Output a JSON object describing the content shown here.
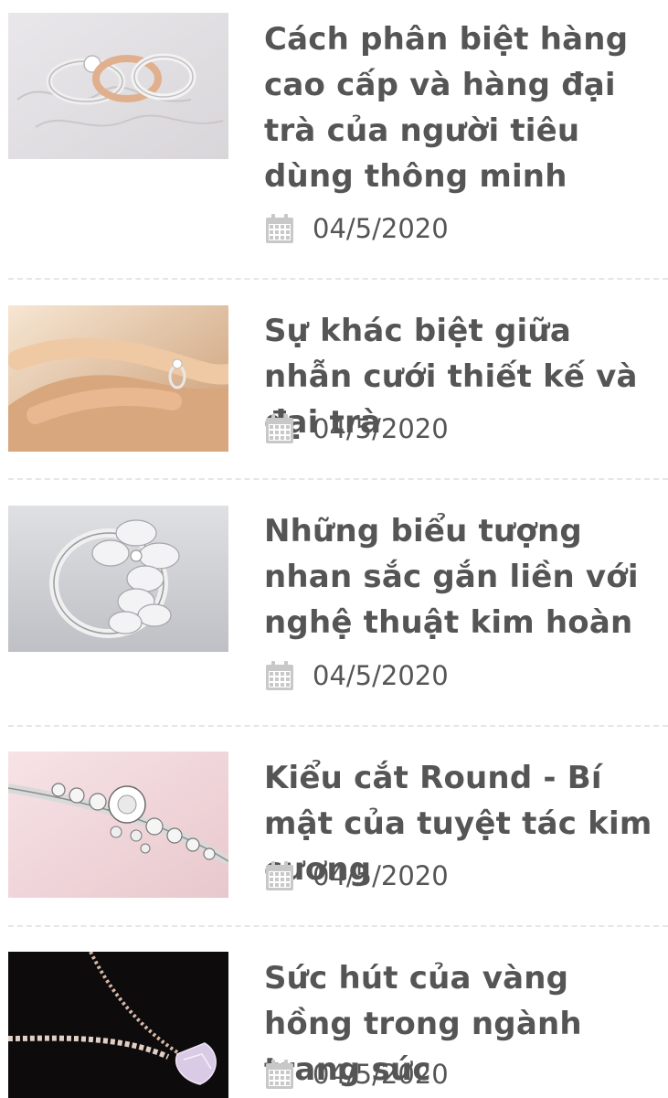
{
  "posts": [
    {
      "title": "Cách phân biệt hàng cao cấp và hàng đại trà của người tiêu dùng thông minh",
      "date": "04/5/2020",
      "thumbnail": "three-wedding-rings-on-card"
    },
    {
      "title": "Sự khác biệt giữa nhẫn cưới thiết kế và đại trà",
      "date": "04/5/2020",
      "thumbnail": "hand-placing-ring-on-finger"
    },
    {
      "title": "Những biểu tượng nhan sắc gắn liền với nghệ thuật kim hoàn",
      "date": "04/5/2020",
      "thumbnail": "flower-diamond-ring"
    },
    {
      "title": "Kiểu cắt Round - Bí mật của tuyệt tác kim cương",
      "date": "04/5/2020",
      "thumbnail": "round-cut-diamond-ring"
    },
    {
      "title": "Sức hút của vàng hồng trong ngành trang sức",
      "date": "04/5/2020",
      "thumbnail": "pendant-necklace-on-black"
    }
  ],
  "colors": {
    "title": "#555555",
    "date": "#555555",
    "icon": "#c8c8c8",
    "divider": "#e6e6e6"
  }
}
